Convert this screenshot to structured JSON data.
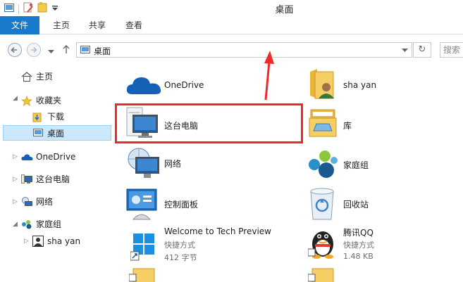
{
  "window": {
    "title": "桌面"
  },
  "ribbon": {
    "tabs": [
      "文件",
      "主页",
      "共享",
      "查看"
    ]
  },
  "address": {
    "path": "桌面",
    "search_placeholder": "搜索"
  },
  "sidebar": {
    "home": "主页",
    "favorites": "收藏夹",
    "downloads": "下载",
    "desktop": "桌面",
    "onedrive": "OneDrive",
    "thispc": "这台电脑",
    "network": "网络",
    "homegroup": "家庭组",
    "user": "sha yan"
  },
  "items": {
    "onedrive": {
      "label": "OneDrive"
    },
    "user": {
      "label": "sha yan"
    },
    "thispc": {
      "label": "这台电脑"
    },
    "library": {
      "label": "库"
    },
    "network": {
      "label": "网络"
    },
    "homegroup": {
      "label": "家庭组"
    },
    "controlpanel": {
      "label": "控制面板"
    },
    "recycle": {
      "label": "回收站"
    },
    "welcome": {
      "label": "Welcome to Tech Preview",
      "type": "快捷方式",
      "size": "412 字节"
    },
    "qq": {
      "label": "腾讯QQ",
      "type": "快捷方式",
      "size": "1.48 KB"
    }
  },
  "colors": {
    "accent": "#1979ca",
    "highlight": "#ec2a2a",
    "selection": "#cce8ff"
  }
}
